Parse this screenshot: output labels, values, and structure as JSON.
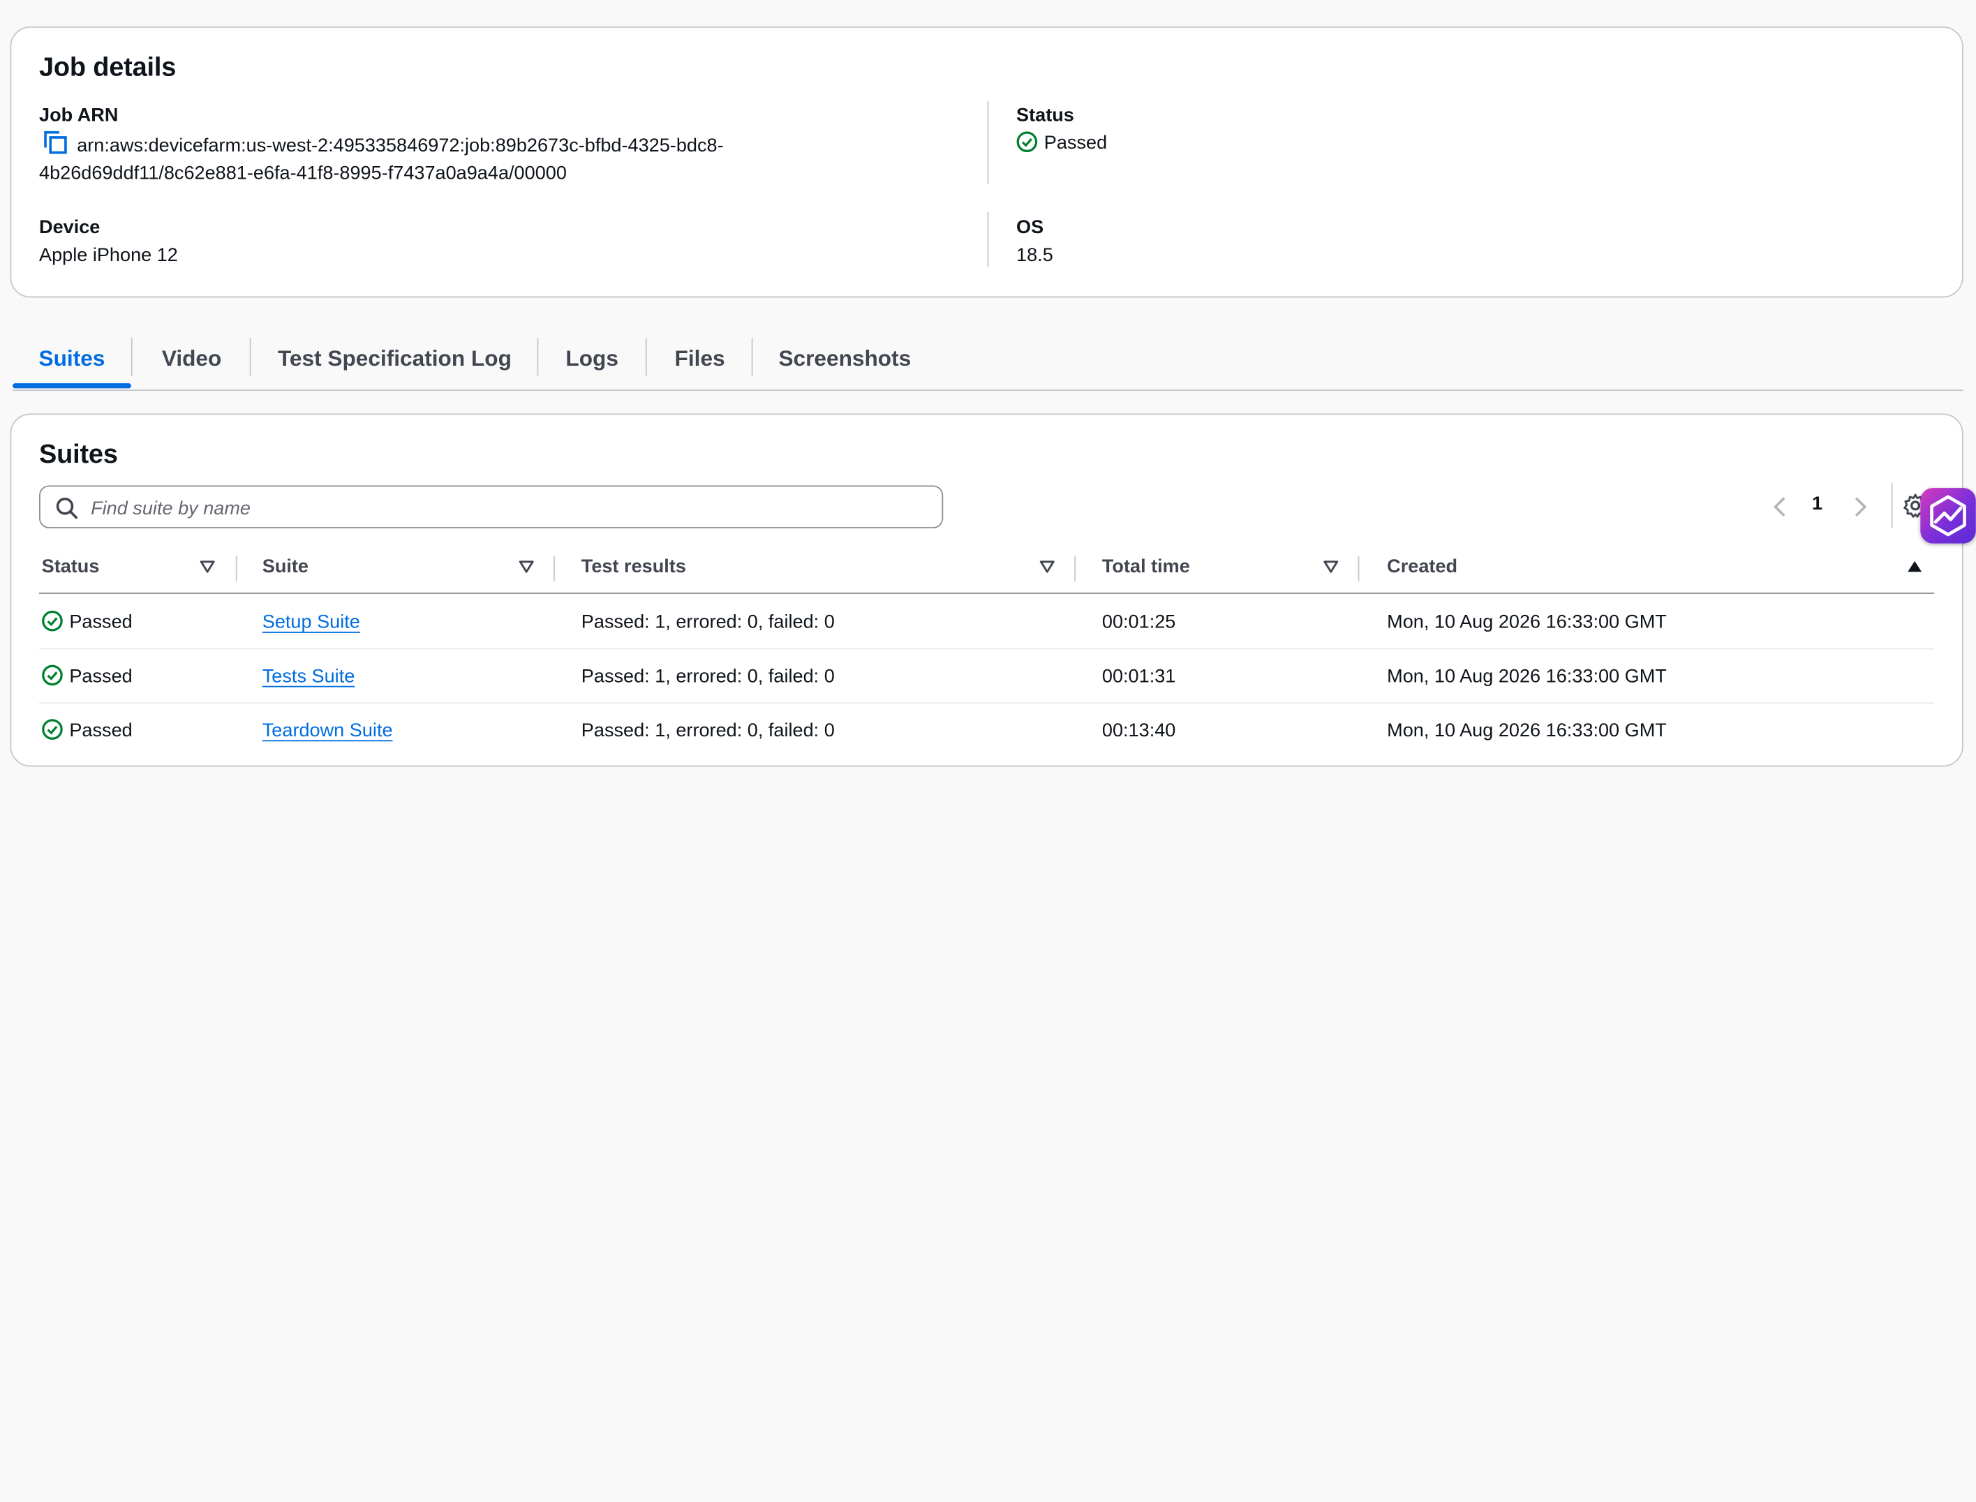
{
  "job_details": {
    "title": "Job details",
    "arn_label": "Job ARN",
    "arn_line1": "arn:aws:devicefarm:us-west-2:495335846972:job:89b2673c-bfbd-4325-bdc8-",
    "arn_line2": "4b26d69ddf11/8c62e881-e6fa-41f8-8995-f7437a0a9a4a/00000",
    "status_label": "Status",
    "status_value": "Passed",
    "device_label": "Device",
    "device_value": "Apple iPhone 12",
    "os_label": "OS",
    "os_value": "18.5"
  },
  "tabs": [
    {
      "label": "Suites",
      "active": true
    },
    {
      "label": "Video"
    },
    {
      "label": "Test Specification Log"
    },
    {
      "label": "Logs"
    },
    {
      "label": "Files"
    },
    {
      "label": "Screenshots"
    }
  ],
  "suites": {
    "title": "Suites",
    "search_placeholder": "Find suite by name",
    "page": "1",
    "columns": [
      "Status",
      "Suite",
      "Test results",
      "Total time",
      "Created"
    ],
    "rows": [
      {
        "status": "Passed",
        "suite": "Setup Suite",
        "results": "Passed: 1, errored: 0, failed: 0",
        "time": "00:01:25",
        "created": "Mon, 10 Aug 2026 16:33:00 GMT"
      },
      {
        "status": "Passed",
        "suite": "Tests Suite",
        "results": "Passed: 1, errored: 0, failed: 0",
        "time": "00:01:31",
        "created": "Mon, 10 Aug 2026 16:33:00 GMT"
      },
      {
        "status": "Passed",
        "suite": "Teardown Suite",
        "results": "Passed: 1, errored: 0, failed: 0",
        "time": "00:13:40",
        "created": "Mon, 10 Aug 2026 16:33:00 GMT"
      }
    ]
  },
  "colors": {
    "accent": "#006ce0",
    "success": "#00802f",
    "border": "#c6c6cd"
  }
}
